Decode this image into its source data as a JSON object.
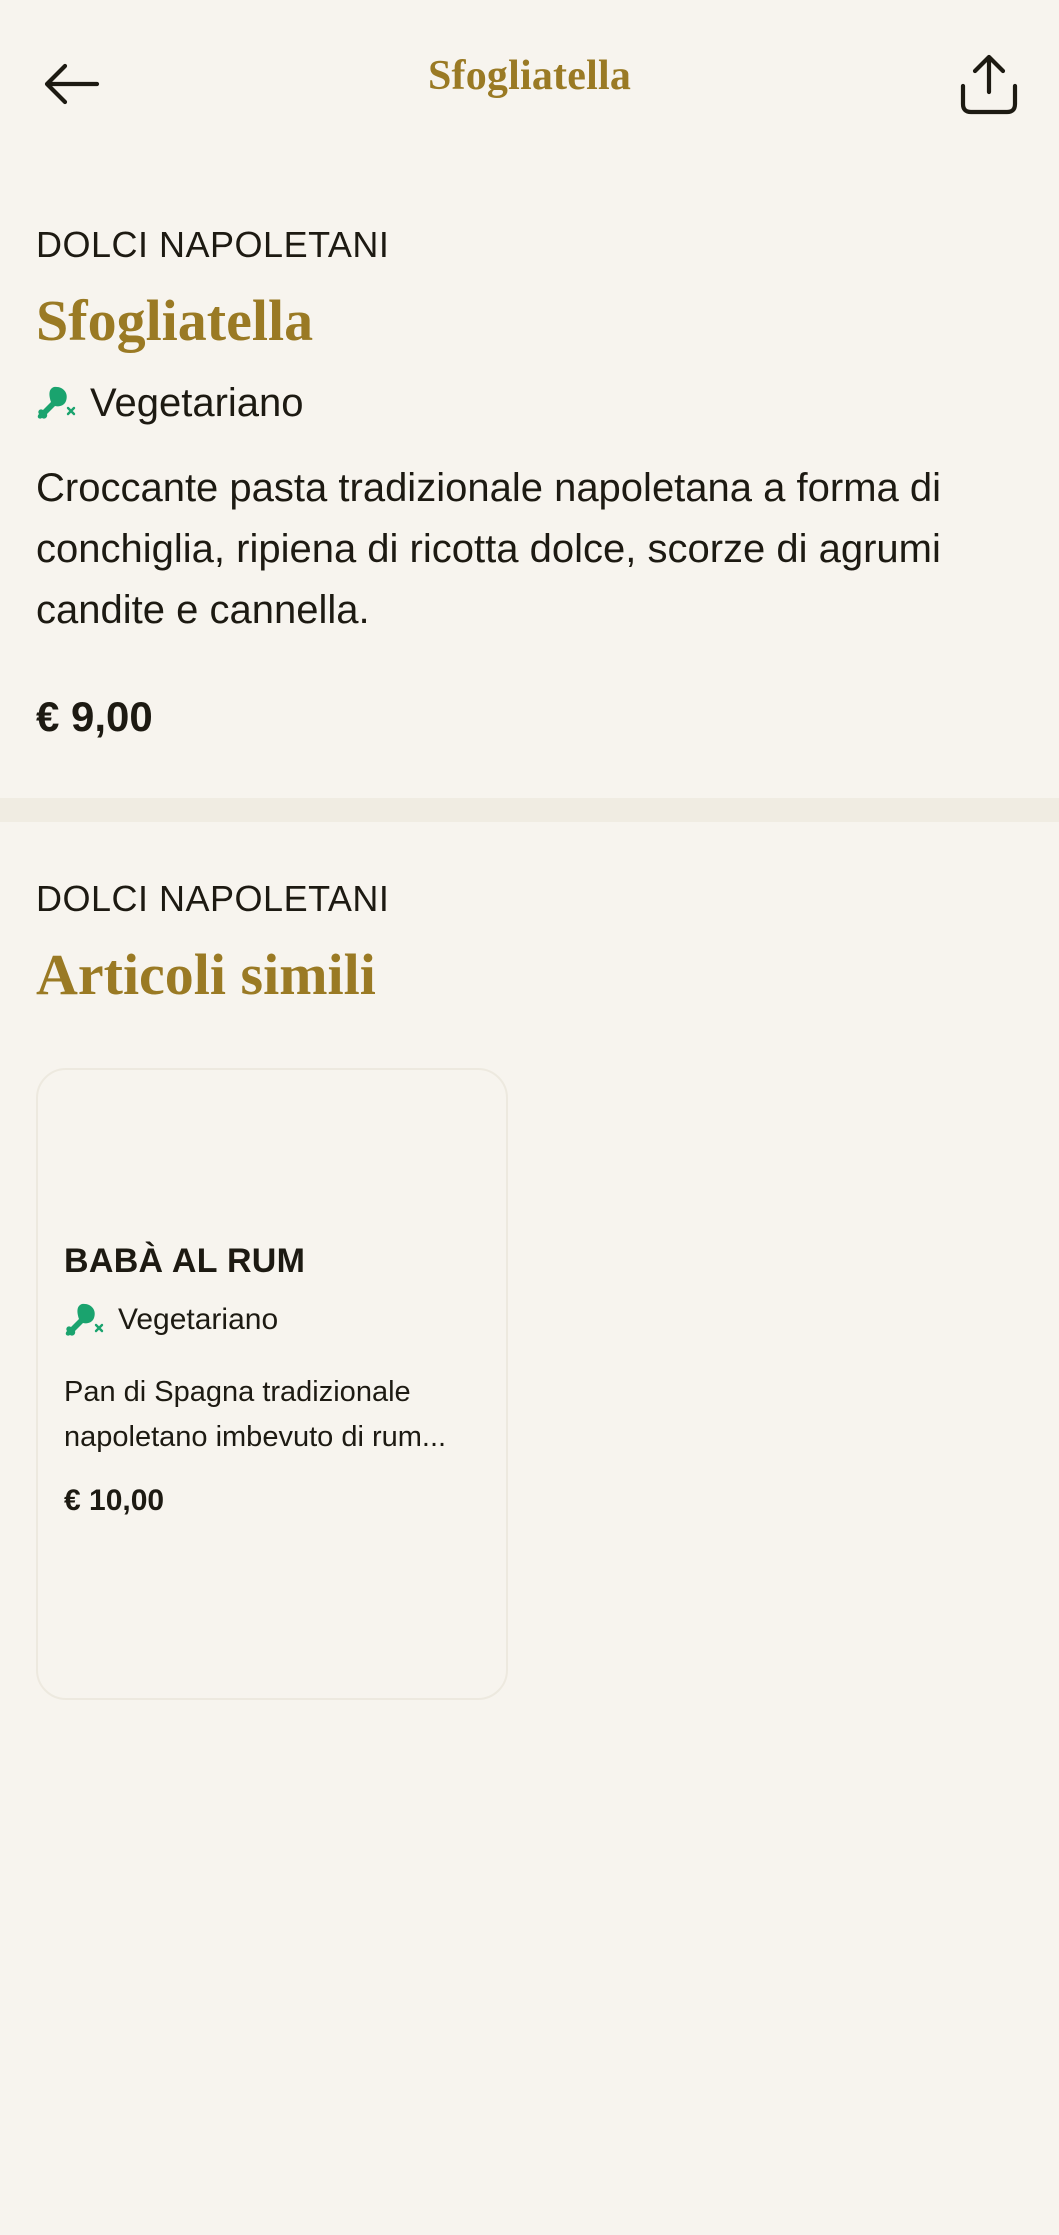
{
  "header": {
    "title": "Sfogliatella",
    "back_icon": "arrow-left-icon",
    "share_icon": "share-icon"
  },
  "product": {
    "category": "DOLCI NAPOLETANI",
    "name": "Sfogliatella",
    "diet_label": "Vegetariano",
    "diet_icon": "no-meat-icon",
    "description": "Croccante pasta tradizionale napoletana a forma di conchiglia, ripiena di ricotta dolce, scorze di agrumi candite e cannella.",
    "price": "€ 9,00"
  },
  "similar": {
    "category": "DOLCI NAPOLETANI",
    "title": "Articoli simili",
    "items": [
      {
        "name": "BABÀ AL RUM",
        "diet_label": "Vegetariano",
        "description": "Pan di Spagna tradizionale napoletano imbevuto di rum...",
        "price": "€ 10,00"
      }
    ]
  },
  "colors": {
    "background": "#f7f4ee",
    "accent": "#9a7a24",
    "diet_green": "#1aa36e",
    "text": "#1d1a12"
  }
}
